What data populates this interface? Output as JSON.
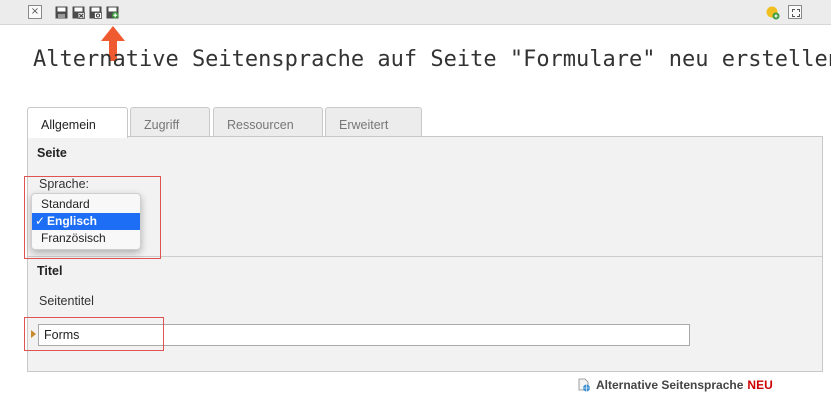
{
  "toolbar": {
    "close_icon": "close-icon",
    "save_icons": [
      "save-icon",
      "save-and-close-icon",
      "save-and-view-icon",
      "save-and-new-icon"
    ],
    "right_icons": [
      "help-icon",
      "fullscreen-icon"
    ]
  },
  "page_title": "Alternative Seitensprache auf Seite \"Formulare\" neu erstellen",
  "tabs": [
    {
      "label": "Allgemein",
      "active": true
    },
    {
      "label": "Zugriff",
      "active": false
    },
    {
      "label": "Ressourcen",
      "active": false
    },
    {
      "label": "Erweitert",
      "active": false
    }
  ],
  "section_page": {
    "heading": "Seite",
    "language_label": "Sprache:",
    "language_options": [
      {
        "label": "Standard",
        "selected": false
      },
      {
        "label": "Englisch",
        "selected": true
      },
      {
        "label": "Französisch",
        "selected": false
      }
    ],
    "check_mark": "✓"
  },
  "section_title": {
    "heading": "Titel",
    "page_title_label": "Seitentitel",
    "page_title_value": "Forms"
  },
  "footer": {
    "link_label": "Alternative Seitensprache",
    "badge": "NEU"
  },
  "colors": {
    "highlight": "#e05353",
    "arrow": "#f05a30",
    "selection": "#1d6ef5",
    "new_badge": "#cc0000"
  }
}
